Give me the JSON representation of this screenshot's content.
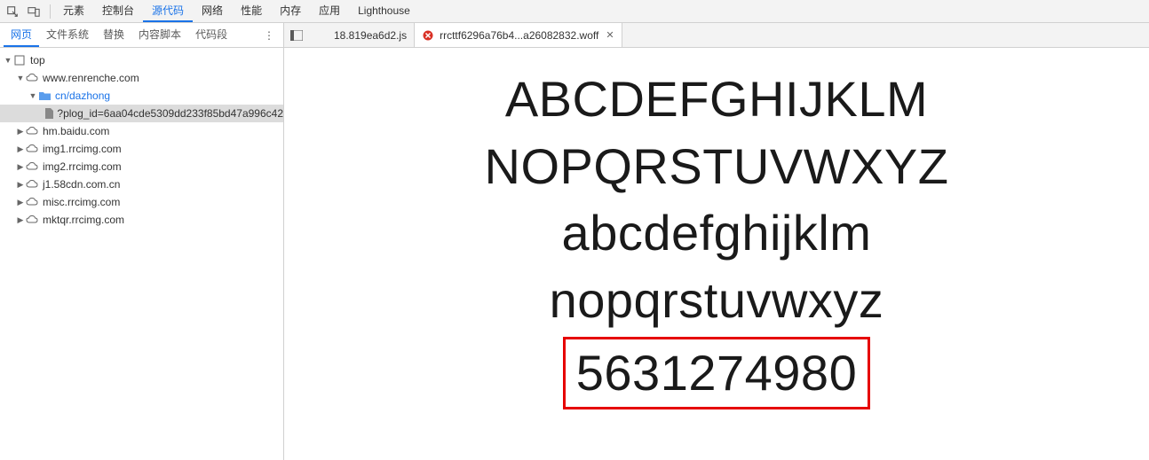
{
  "toolbar": {
    "tabs": [
      "元素",
      "控制台",
      "源代码",
      "网络",
      "性能",
      "内存",
      "应用",
      "Lighthouse"
    ],
    "activeIndex": 2
  },
  "subTabs": {
    "items": [
      "网页",
      "文件系统",
      "替换",
      "内容脚本",
      "代码段"
    ],
    "activeIndex": 0
  },
  "tree": {
    "root": "top",
    "domains": [
      {
        "name": "www.renrenche.com",
        "expanded": true,
        "children": [
          {
            "name": "cn/dazhong",
            "type": "folder",
            "expanded": true,
            "children": [
              {
                "name": "?plog_id=6aa04cde5309dd233f85bd47a996c42",
                "type": "file",
                "selected": true
              }
            ]
          }
        ]
      },
      {
        "name": "hm.baidu.com",
        "expanded": false
      },
      {
        "name": "img1.rrcimg.com",
        "expanded": false
      },
      {
        "name": "img2.rrcimg.com",
        "expanded": false
      },
      {
        "name": "j1.58cdn.com.cn",
        "expanded": false
      },
      {
        "name": "misc.rrcimg.com",
        "expanded": false
      },
      {
        "name": "mktqr.rrcimg.com",
        "expanded": false
      }
    ]
  },
  "fileTabs": {
    "items": [
      {
        "label": "18.819ea6d2.js",
        "icon": "js",
        "active": false
      },
      {
        "label": "rrcttf6296a76b4...a26082832.woff",
        "icon": "error",
        "active": true
      }
    ]
  },
  "fontPreview": {
    "line1": "ABCDEFGHIJKLM",
    "line2": "NOPQRSTUVWXYZ",
    "line3": "abcdefghijklm",
    "line4": "nopqrstuvwxyz",
    "line5": "5631274980"
  }
}
